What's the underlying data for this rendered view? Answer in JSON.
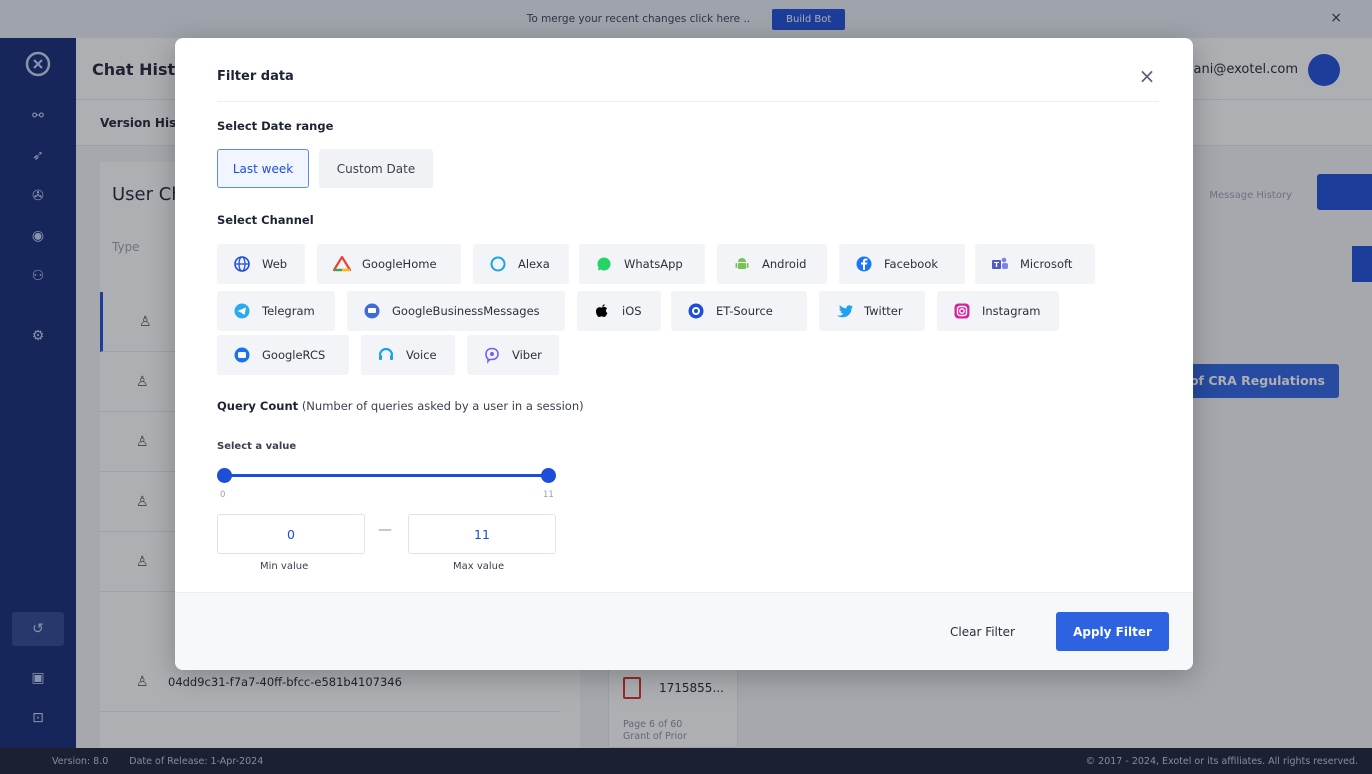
{
  "banner": {
    "text": "To merge your recent changes click here ..",
    "button": "Build Bot",
    "close": "×"
  },
  "header": {
    "title": "Chat Histo",
    "email": "iani@exotel.com"
  },
  "subnav": {
    "item": "Version His"
  },
  "list": {
    "title": "User Ch",
    "search_placeholder": "Type",
    "last_row_id": "04dd9c31-f7a7-40ff-bfcc-e581b4107346"
  },
  "right_panel": {
    "tab_label": "Message History",
    "cra_label": "of CRA Regulations"
  },
  "file_card": {
    "name": "1715855...",
    "meta_line1": "Page 6 of 60",
    "meta_line2": "Grant of Prior"
  },
  "footer": {
    "version": "Version: 8.0",
    "release": "Date of Release: 1-Apr-2024",
    "copyright": "© 2017 - 2024, Exotel or its affiliates. All rights reserved."
  },
  "modal": {
    "title": "Filter data",
    "close": "×",
    "date_section_label": "Select Date range",
    "date_options": [
      {
        "label": "Last week",
        "active": true
      },
      {
        "label": "Custom Date",
        "active": false
      }
    ],
    "channel_section_label": "Select Channel",
    "channels": [
      {
        "label": "Web",
        "icon": "globe-icon",
        "color": "#1d4ed8"
      },
      {
        "label": "GoogleHome",
        "icon": "google-home-icon",
        "color": "#ea4335"
      },
      {
        "label": "Alexa",
        "icon": "alexa-icon",
        "color": "#1aa3e8"
      },
      {
        "label": "WhatsApp",
        "icon": "whatsapp-icon",
        "color": "#25d366"
      },
      {
        "label": "Android",
        "icon": "android-icon",
        "color": "#78c257"
      },
      {
        "label": "Facebook",
        "icon": "facebook-icon",
        "color": "#1877f2"
      },
      {
        "label": "Microsoft",
        "icon": "teams-icon",
        "color": "#5059c9"
      },
      {
        "label": "Telegram",
        "icon": "telegram-icon",
        "color": "#2aabee"
      },
      {
        "label": "GoogleBusinessMessages",
        "icon": "business-messages-icon",
        "color": "#3f6ad8"
      },
      {
        "label": "iOS",
        "icon": "apple-icon",
        "color": "#000000"
      },
      {
        "label": "ET-Source",
        "icon": "et-source-icon",
        "color": "#1d4ed8"
      },
      {
        "label": "Twitter",
        "icon": "twitter-icon",
        "color": "#1da1f2"
      },
      {
        "label": "Instagram",
        "icon": "instagram-icon",
        "color": "#d6249f"
      },
      {
        "label": "GoogleRCS",
        "icon": "rcs-icon",
        "color": "#1a73e8"
      },
      {
        "label": "Voice",
        "icon": "voice-icon",
        "color": "#1aa3e8"
      },
      {
        "label": "Viber",
        "icon": "viber-icon",
        "color": "#7360f2"
      }
    ],
    "query_title": "Query Count",
    "query_subtitle": "(Number of queries asked by a user in a session)",
    "select_value_label": "Select a value",
    "slider": {
      "min": 0,
      "max": 11,
      "min_tick": "0",
      "max_tick": "11"
    },
    "min_value": "0",
    "max_value": "11",
    "min_caption": "Min value",
    "max_caption": "Max value",
    "dash": "—",
    "clear_label": "Clear Filter",
    "apply_label": "Apply Filter"
  }
}
